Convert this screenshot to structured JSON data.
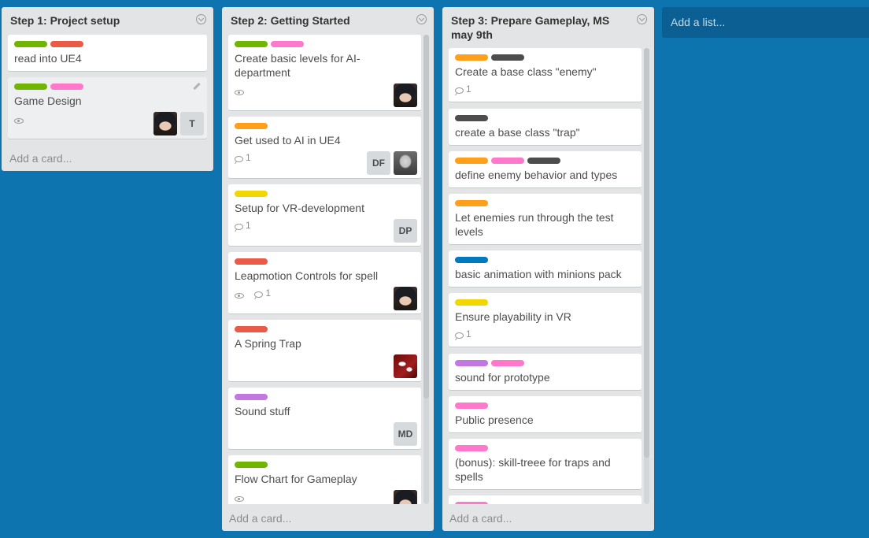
{
  "colors": {
    "board_bg": "#0e74b0",
    "green": "#70b500",
    "red": "#eb5a46",
    "pink": "#ff78cb",
    "orange": "#ff9f1a",
    "black": "#4d4d4d",
    "yellow": "#f2d600",
    "blue": "#0079bf",
    "purple": "#c377e0"
  },
  "lists": [
    {
      "title": "Step 1: Project setup",
      "add_card": "Add a card...",
      "cards": [
        {
          "title": "read into UE4",
          "labels": [
            "green",
            "red"
          ]
        },
        {
          "title": "Game Design",
          "labels": [
            "green",
            "pink"
          ],
          "watch": true,
          "members": [
            "avatar-anime",
            "T"
          ],
          "edit_icon": "pencil-icon"
        }
      ]
    },
    {
      "title": "Step 2: Getting Started",
      "add_card": "Add a card...",
      "cards": [
        {
          "title": "Create basic levels for AI-department",
          "labels": [
            "green",
            "pink"
          ],
          "watch": true,
          "members": [
            "avatar-anime"
          ]
        },
        {
          "title": "Get used to AI in UE4",
          "labels": [
            "orange"
          ],
          "comments": "1",
          "members": [
            "DF",
            "avatar-grey"
          ]
        },
        {
          "title": "Setup for VR-development",
          "labels": [
            "yellow"
          ],
          "comments": "1",
          "members": [
            "DP"
          ]
        },
        {
          "title": "Leapmotion Controls for spell",
          "labels": [
            "red"
          ],
          "watch": true,
          "comments": "1",
          "members": [
            "avatar-anime"
          ]
        },
        {
          "title": "A Spring Trap",
          "labels": [
            "red"
          ],
          "members": [
            "avatar-red"
          ]
        },
        {
          "title": "Sound stuff",
          "labels": [
            "purple"
          ],
          "members": [
            "MD"
          ]
        },
        {
          "title": "Flow Chart for Gameplay",
          "labels": [
            "green"
          ],
          "watch": true,
          "members": [
            "avatar-anime"
          ]
        }
      ]
    },
    {
      "title": "Step 3: Prepare Gameplay, MS may 9th",
      "add_card": "Add a card...",
      "cards": [
        {
          "title": "Create a base class \"enemy\"",
          "labels": [
            "orange",
            "black"
          ],
          "comments": "1"
        },
        {
          "title": "create a base class \"trap\"",
          "labels": [
            "black"
          ]
        },
        {
          "title": "define enemy behavior and types",
          "labels": [
            "orange",
            "pink",
            "black"
          ]
        },
        {
          "title": "Let enemies run through the test levels",
          "labels": [
            "orange"
          ]
        },
        {
          "title": "basic animation with minions pack",
          "labels": [
            "blue"
          ]
        },
        {
          "title": "Ensure playability in VR",
          "labels": [
            "yellow"
          ],
          "comments": "1"
        },
        {
          "title": "sound for prototype",
          "labels": [
            "purple",
            "pink"
          ]
        },
        {
          "title": "Public presence",
          "labels": [
            "pink"
          ]
        },
        {
          "title": "(bonus): skill-treee for traps and spells",
          "labels": [
            "pink"
          ]
        },
        {
          "title": "",
          "labels": [
            "pink"
          ]
        }
      ]
    }
  ],
  "add_list": "Add a list..."
}
